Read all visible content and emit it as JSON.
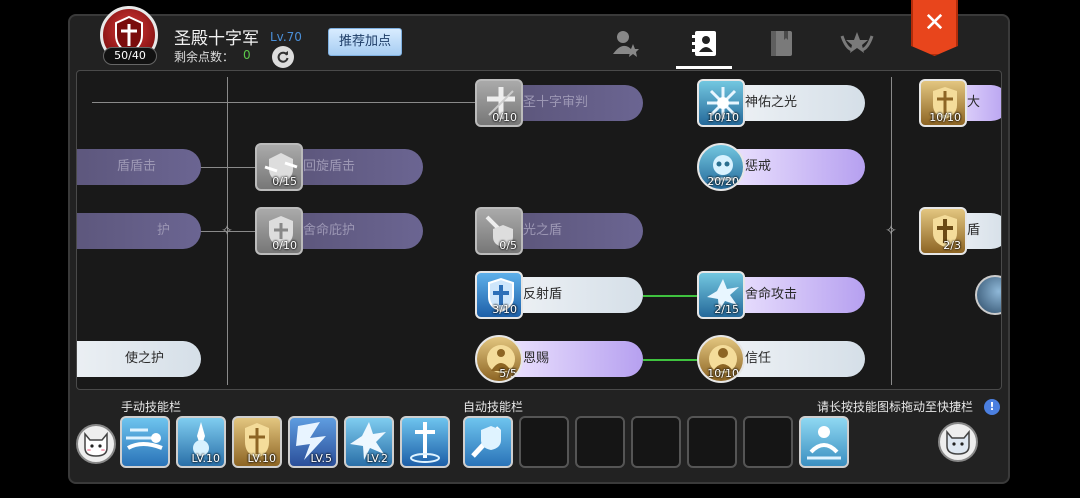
{
  "header": {
    "class_name": "圣殿十字军",
    "level": "Lv.70",
    "points_label": "剩余点数：",
    "points_value": "0",
    "emblem_badge": "50/40",
    "recommend_button": "推荐加点",
    "close_glyph": "✕"
  },
  "tabs": [
    {
      "icon": "character-star-icon"
    },
    {
      "icon": "skill-book-icon",
      "active": true
    },
    {
      "icon": "book-icon"
    },
    {
      "icon": "wings-star-icon"
    }
  ],
  "tree": {
    "col0": [
      {
        "name": "盾击",
        "partial": "盾盾击",
        "style": "dim"
      },
      {
        "name": "守护",
        "partial": "护",
        "style": "dim"
      },
      {
        "name": "天使之护",
        "partial": "使之护",
        "style": "light"
      }
    ],
    "col1": [
      {
        "name": "回旋盾击",
        "level": "0/15",
        "style": "dim"
      },
      {
        "name": "舍命庇护",
        "level": "0/10",
        "style": "dim"
      }
    ],
    "col2": [
      {
        "name": "圣十字审判",
        "level": "0/10",
        "style": "dim"
      },
      {
        "name": "光之盾",
        "level": "0/5",
        "style": "dim"
      },
      {
        "name": "反射盾",
        "level": "3/10",
        "style": "light"
      },
      {
        "name": "恩赐",
        "level": "5/5",
        "style": "purple"
      }
    ],
    "col3": [
      {
        "name": "神佑之光",
        "level": "10/10",
        "style": "light"
      },
      {
        "name": "惩戒",
        "level": "20/20",
        "style": "purple"
      },
      {
        "name": "舍命攻击",
        "level": "2/15",
        "style": "purple"
      },
      {
        "name": "信任",
        "level": "10/10",
        "style": "light"
      }
    ],
    "col4": [
      {
        "name": "大",
        "level": "10/10"
      },
      {
        "name": "盾",
        "level": "2/3"
      }
    ]
  },
  "bottom": {
    "manual_label": "手动技能栏",
    "auto_label": "自动技能栏",
    "hint": "请长按技能图标拖动至快捷栏",
    "manual_slots": [
      {
        "icon": "rush-skill-icon",
        "level": ""
      },
      {
        "icon": "light-skill-icon",
        "level": "LV.10"
      },
      {
        "icon": "holy-shield-skill-icon",
        "level": "LV.10"
      },
      {
        "icon": "lightning-skill-icon",
        "level": "LV.5"
      },
      {
        "icon": "burst-skill-icon",
        "level": "LV.2"
      },
      {
        "icon": "holy-pillar-skill-icon",
        "level": ""
      }
    ],
    "auto_slots": [
      {
        "icon": "shield-strike-skill-icon",
        "filled": true
      },
      {
        "filled": false
      },
      {
        "filled": false
      },
      {
        "filled": false
      },
      {
        "filled": false
      },
      {
        "filled": false
      }
    ],
    "extra_slot": {
      "icon": "revive-skill-icon"
    }
  },
  "colors": {
    "accent_blue": "#4a8fd8",
    "points_green": "#5bc94a",
    "close_red": "#e8451c",
    "link_green": "#3fc23f"
  }
}
